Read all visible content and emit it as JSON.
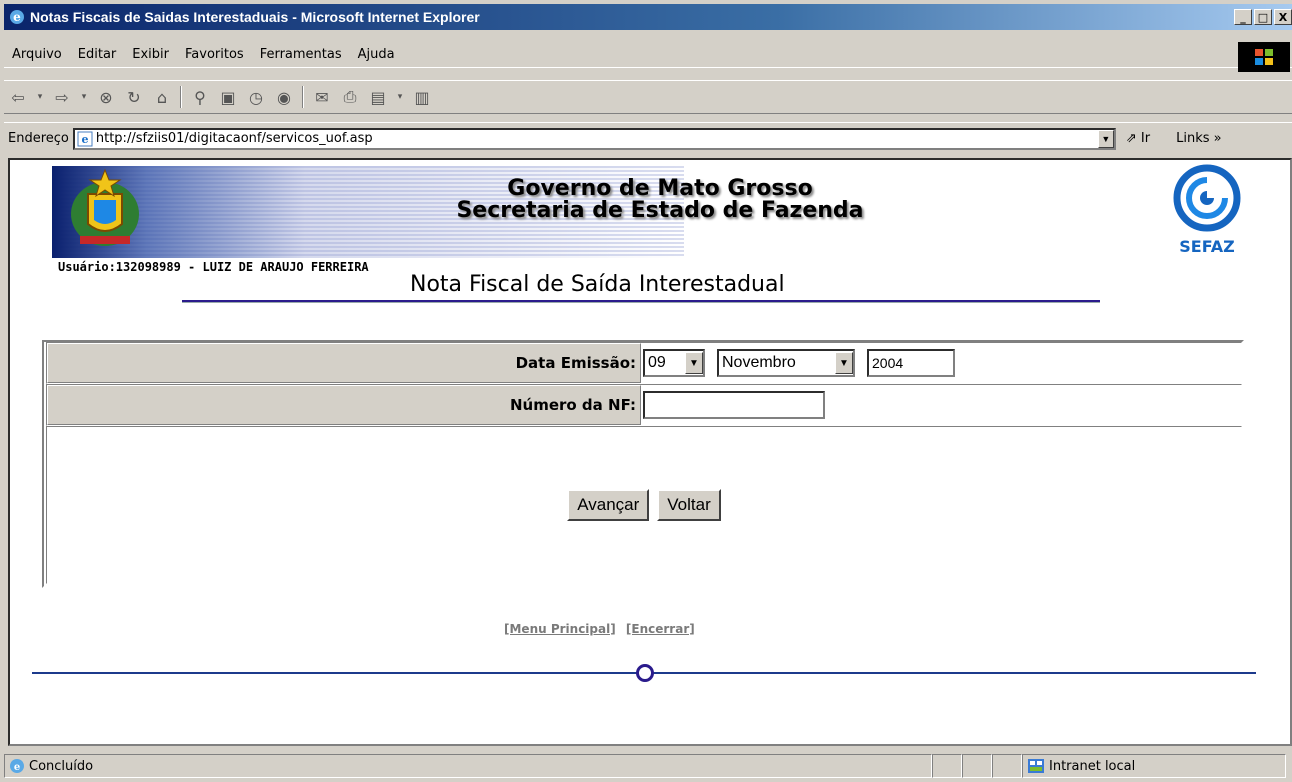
{
  "window": {
    "title": "Notas Fiscais de Saidas Interestaduais - Microsoft Internet Explorer",
    "minimize": "_",
    "maximize": "□",
    "close": "X"
  },
  "menubar": {
    "items": [
      "Arquivo",
      "Editar",
      "Exibir",
      "Favoritos",
      "Ferramentas",
      "Ajuda"
    ]
  },
  "toolbar": {
    "icons": [
      "back-icon",
      "forward-icon",
      "stop-icon",
      "refresh-icon",
      "home-icon",
      "search-icon",
      "favorites-icon",
      "history-icon",
      "media-icon",
      "mail-icon",
      "print-icon",
      "edit-icon",
      "discuss-icon"
    ]
  },
  "address": {
    "label": "Endereço",
    "url": "http://sfziis01/digitacaonf/servicos_uof.asp",
    "go_label": "Ir",
    "links_label": "Links »"
  },
  "page": {
    "gov_line1": "Governo de Mato Grosso",
    "gov_line2": "Secretaria de Estado de Fazenda",
    "sefaz_label": "SEFAZ",
    "usuario": "Usuário:132098989 - LUIZ DE ARAUJO FERREIRA",
    "heading": "Nota Fiscal de Saída Interestadual"
  },
  "form": {
    "data_emissao_label": "Data Emissão:",
    "day_value": "09",
    "month_value": "Novembro",
    "year_value": "2004",
    "numero_nf_label": "Número da NF:",
    "numero_nf_value": "",
    "avancar_label": "Avançar",
    "voltar_label": "Voltar"
  },
  "footer": {
    "menu_principal": "[Menu Principal]",
    "encerrar": "[Encerrar]"
  },
  "statusbar": {
    "status": "Concluído",
    "zone": "Intranet local"
  }
}
